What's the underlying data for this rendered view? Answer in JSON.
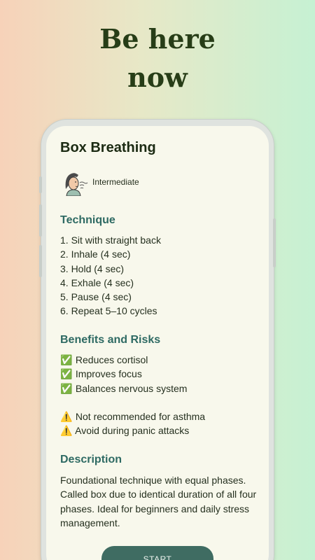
{
  "headline": {
    "line1": "Be here",
    "line2": "now"
  },
  "card": {
    "title": "Box Breathing",
    "level": "Intermediate",
    "technique": {
      "heading": "Technique",
      "steps": [
        "1. Sit with straight back",
        "2. Inhale (4 sec)",
        "3. Hold (4 sec)",
        "4. Exhale (4 sec)",
        "5. Pause (4 sec)",
        "6. Repeat 5–10 cycles"
      ]
    },
    "benefits": {
      "heading": "Benefits and Risks",
      "benefit_icon": "✅",
      "benefit_items": [
        "Reduces cortisol",
        "Improves focus",
        "Balances nervous system"
      ],
      "risk_icon": "⚠️",
      "risk_items": [
        "Not recommended for asthma",
        "Avoid during panic attacks"
      ]
    },
    "description": {
      "heading": "Description",
      "text": "Foundational technique with equal phases. Called box due to identical duration of all four phases. Ideal for beginners and daily stress management."
    },
    "start_label": "START"
  },
  "colors": {
    "headline": "#273d17",
    "section_heading": "#2e6a63",
    "button": "#3f6c62",
    "screen_bg": "#f8f8ec"
  },
  "icons": {
    "avatar": "breathing-person-icon"
  }
}
